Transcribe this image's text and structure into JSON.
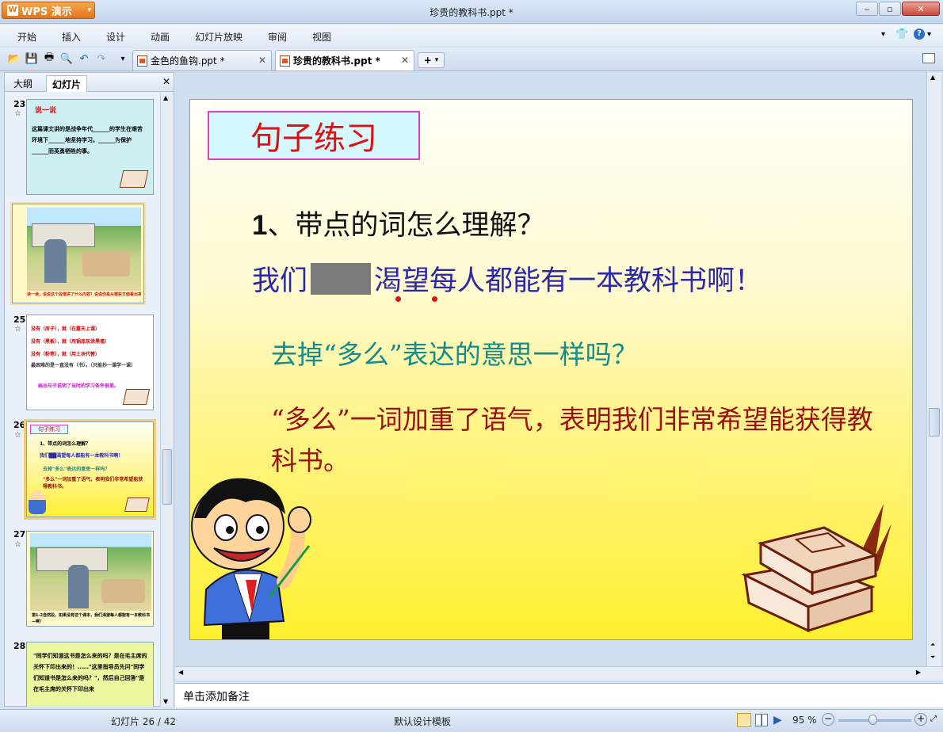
{
  "app": {
    "button_label": "WPS 演示",
    "window_title": "珍贵的教科书.ppt *"
  },
  "menu": [
    "开始",
    "插入",
    "设计",
    "动画",
    "幻灯片放映",
    "审阅",
    "视图"
  ],
  "tabs": [
    {
      "label": "金色的鱼钩.ppt *",
      "active": false
    },
    {
      "label": "珍贵的教科书.ppt *",
      "active": true
    }
  ],
  "left_panel": {
    "tabs": [
      "大纲",
      "幻灯片"
    ],
    "thumbnails": [
      {
        "num": "23",
        "title": "说一说",
        "text": "这篇课文讲的是战争年代______的学生在艰苦环境下______地坚持学习。______为保护______而英勇牺牲的事。"
      },
      {
        "num": "24",
        "caption": "读一读，说说这个段落讲了什么内容？说说你是从哪些方面看出来的。"
      },
      {
        "num": "25",
        "lines": [
          "没有（房子），就（在露天上课）",
          "没有（黑板），就（用锅底灰涂黑墙）",
          "没有（粉笔），就（用土块代替）",
          "最困难的是一直没有（书）。（只能抄一课学一课）",
          "画出句子说明了当时的学习条件很差。"
        ]
      },
      {
        "num": "26",
        "title": "句子练习",
        "lines": [
          "1、带点的词怎么理解？",
          "我们██渴望每人都能有一本教科书啊！",
          "去掉\"多么\"表达的意思一样吗？",
          "\"多么\"一词加重了语气，表明我们非常希望能获得教科书。"
        ]
      },
      {
        "num": "27",
        "caption": "第1-2自然段，如果没有这个课本，我们渴望每人都能有一本教科书—啊！"
      },
      {
        "num": "28",
        "lines": [
          "\"同学们知道这书是怎么来的吗？是在毛主席的关怀下印出来的！……\"这里指导员先问\"同学们知道书是怎么来的吗？\"，然后自己回答\"是在毛主席的关怀下印出来"
        ]
      }
    ]
  },
  "slide": {
    "title": "句子练习",
    "question1_num": "1",
    "question1": "、带点的词怎么理解？",
    "sentence_before": "我们",
    "sentence_after": "渴望每人都能有一本教科书啊！",
    "question2": "去掉“多么”表达的意思一样吗？",
    "answer": "“多么”一词加重了语气，表明我们非常希望能获得教科书。"
  },
  "notes_placeholder": "单击添加备注",
  "status": {
    "slide_counter": "幻灯片 26 / 42",
    "template": "默认设计模板",
    "zoom": "95 %"
  },
  "colors": {
    "title_red": "#e01010",
    "sentence_blue": "#2a2aa8",
    "question_teal": "#138c8c",
    "answer_red": "#9c1010"
  }
}
